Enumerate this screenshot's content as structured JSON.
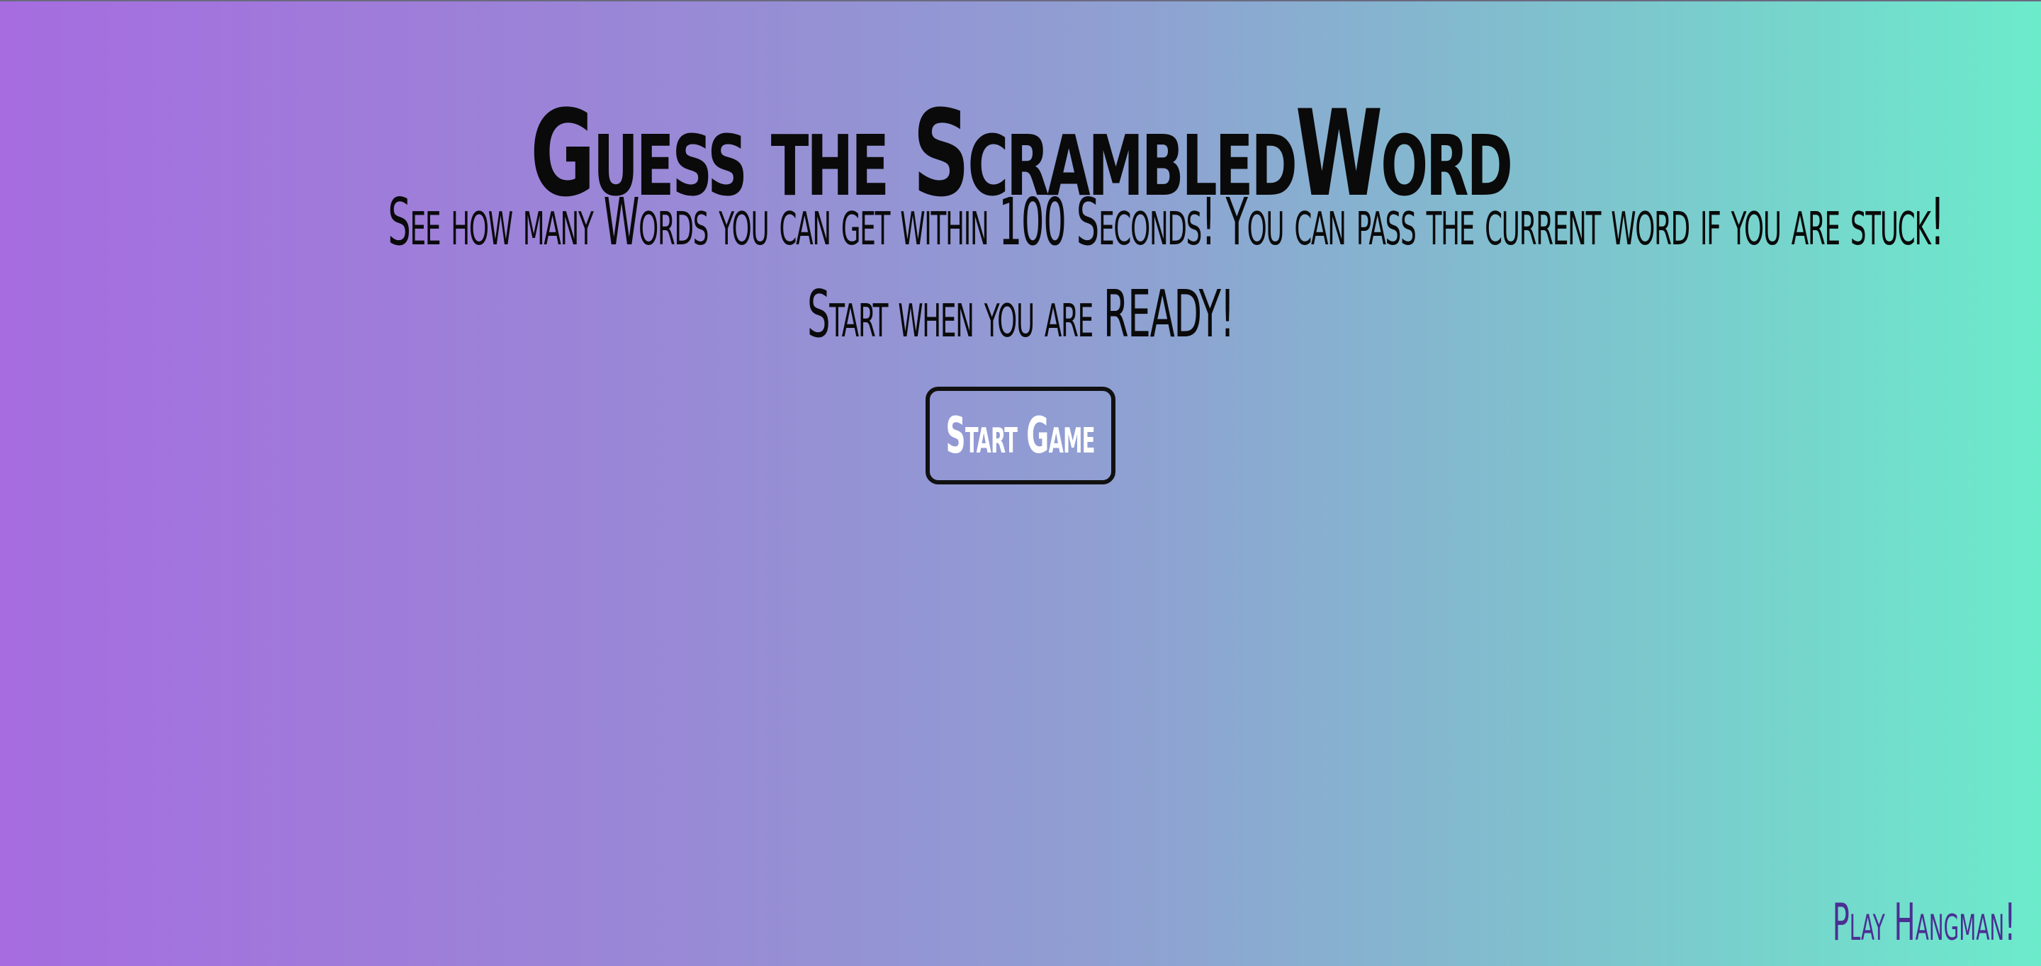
{
  "page": {
    "title": "Guess the ScrambledWord",
    "intro_line": "See how many Words you can get within 100 Seconds! You can pass the current word if you are stuck!",
    "ready_line": "Start when you are READY!",
    "start_button_label": "Start Game",
    "hangman_link_label": "Play Hangman!"
  },
  "colors": {
    "gradient_start": "#a66ce0",
    "gradient_end": "#6cebcb",
    "start_label": "#ffffff",
    "link": "#4b2f93"
  }
}
